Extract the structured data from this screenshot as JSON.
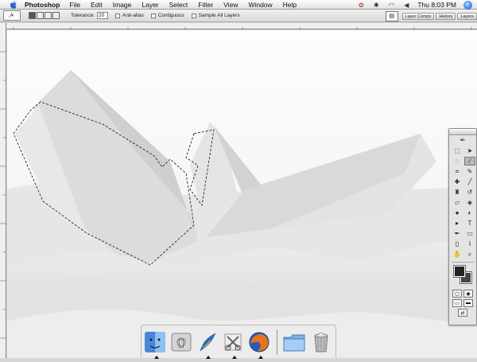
{
  "menubar": {
    "app_name": "Photoshop",
    "items": [
      "File",
      "Edit",
      "Image",
      "Layer",
      "Select",
      "Filter",
      "View",
      "Window",
      "Help"
    ],
    "clock": "Thu 8:03 PM"
  },
  "options": {
    "tolerance_label": "Tolerance:",
    "tolerance_value": "20",
    "anti_alias_label": "Anti-alias",
    "contiguous_label": "Contiguous",
    "sample_all_label": "Sample All Layers"
  },
  "palette_well": {
    "tabs": [
      "Layer Comps",
      "History",
      "Layers"
    ]
  },
  "toolbox": {
    "tools": [
      "marquee-tool",
      "move-tool",
      "lasso-tool",
      "magic-wand-tool",
      "crop-tool",
      "slice-tool",
      "healing-brush-tool",
      "brush-tool",
      "clone-stamp-tool",
      "history-brush-tool",
      "eraser-tool",
      "paint-bucket-tool",
      "blur-tool",
      "dodge-tool",
      "path-selection-tool",
      "type-tool",
      "pen-tool",
      "shape-tool",
      "notes-tool",
      "eyedropper-tool",
      "hand-tool",
      "zoom-tool"
    ],
    "active_tool": "magic-wand-tool",
    "foreground_color": "#222222",
    "background_color": "#444444"
  },
  "dock": {
    "apps": [
      "Finder",
      "System Preferences",
      "Photoshop",
      "Script Editor",
      "Firefox",
      "Documents",
      "Trash"
    ]
  }
}
